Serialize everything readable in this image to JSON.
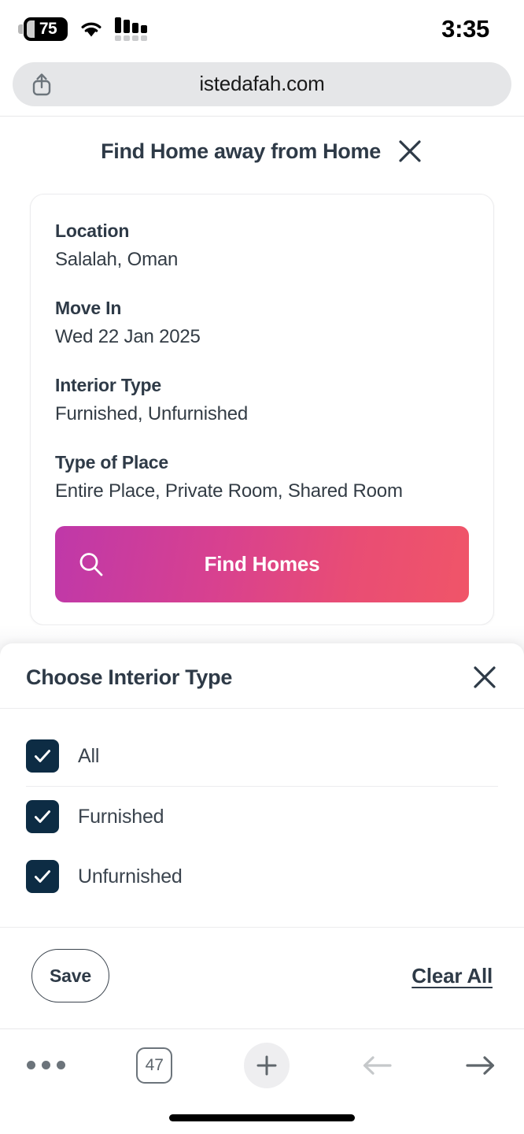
{
  "status_bar": {
    "battery_level": "75",
    "battery_icon": "battery-icon",
    "wifi_icon": "wifi-icon",
    "signal_icon": "cellular-signal-icon",
    "time": "3:35"
  },
  "browser": {
    "url": "istedafah.com",
    "share_icon": "share-icon",
    "toolbar": {
      "menu_icon": "more-options-icon",
      "tab_count": "47",
      "new_tab_icon": "plus-icon",
      "back_icon": "arrow-left-icon",
      "forward_icon": "arrow-right-icon"
    }
  },
  "page": {
    "title": "Find Home away from Home",
    "close_icon": "close-icon",
    "card": {
      "fields": [
        {
          "label": "Location",
          "value": "Salalah, Oman"
        },
        {
          "label": "Move In",
          "value": "Wed 22 Jan 2025"
        },
        {
          "label": "Interior Type",
          "value": "Furnished, Unfurnished"
        },
        {
          "label": "Type of Place",
          "value": "Entire Place, Private Room, Shared Room"
        }
      ],
      "find_button": {
        "label": "Find Homes",
        "search_icon": "search-icon",
        "gradient_start": "#bf38a9",
        "gradient_end": "#f05568"
      }
    }
  },
  "sheet": {
    "title": "Choose Interior Type",
    "close_icon": "close-icon",
    "checkbox_color": "#0d2c44",
    "options": [
      {
        "label": "All",
        "checked": true
      },
      {
        "label": "Furnished",
        "checked": true
      },
      {
        "label": "Unfurnished",
        "checked": true
      }
    ],
    "footer": {
      "save_label": "Save",
      "clear_all_label": "Clear All"
    }
  }
}
